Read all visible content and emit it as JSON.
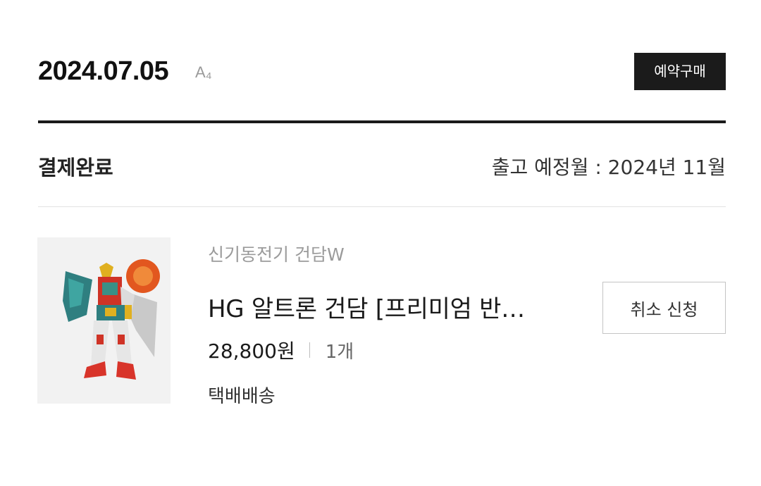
{
  "order": {
    "date": "2024.07.05",
    "number_truncated": "A₄",
    "type_badge": "예약구매",
    "status": "결제완료",
    "ship_estimate": "출고 예정월 : 2024년 11월"
  },
  "item": {
    "series": "신기동전기 건담W",
    "name": "HG 알트론 건담 [프리미엄 반…",
    "price": "28,800원",
    "quantity": "1개",
    "delivery": "택배배송",
    "cancel_label": "취소 신청",
    "image_icon": "gundam-model-image"
  },
  "colors": {
    "badge_bg": "#1b1b1b",
    "divider": "#1a1a1a",
    "muted_text": "#9b9b9b"
  }
}
